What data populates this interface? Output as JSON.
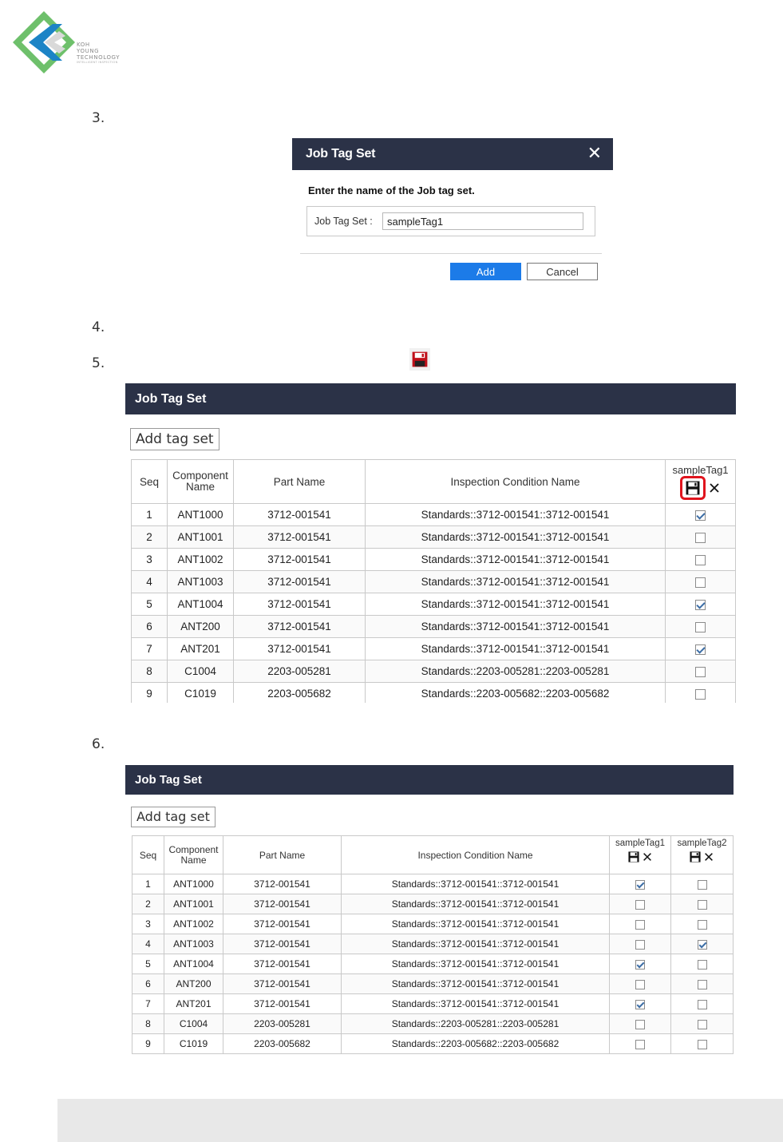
{
  "logo": {
    "line1": "KOH",
    "line2": "YOUNG",
    "line3": "TECHNOLOGY",
    "tagline": "INTELLIGENT INSPECTION",
    "colors": {
      "green": "#6ec06b",
      "blue": "#1c84c6",
      "gray": "#d9d9d9"
    }
  },
  "steps": [
    "3.",
    "4.",
    "5.",
    "6."
  ],
  "dialog": {
    "title": "Job Tag Set",
    "close_icon": "close-icon",
    "prompt": "Enter the name of the Job tag set.",
    "field_label": "Job Tag Set :",
    "field_value": "sampleTag1",
    "add_label": "Add",
    "cancel_label": "Cancel"
  },
  "panel1": {
    "title": "Job Tag Set",
    "add_tag_label": "Add tag set",
    "columns": {
      "seq": "Seq",
      "component": "Component Name",
      "part": "Part Name",
      "condition": "Inspection Condition Name"
    },
    "tags": [
      "sampleTag1"
    ],
    "rows": [
      {
        "seq": "1",
        "component": "ANT1000",
        "part": "3712-001541",
        "condition": "Standards::3712-001541::3712-001541",
        "checks": [
          true
        ]
      },
      {
        "seq": "2",
        "component": "ANT1001",
        "part": "3712-001541",
        "condition": "Standards::3712-001541::3712-001541",
        "checks": [
          false
        ]
      },
      {
        "seq": "3",
        "component": "ANT1002",
        "part": "3712-001541",
        "condition": "Standards::3712-001541::3712-001541",
        "checks": [
          false
        ]
      },
      {
        "seq": "4",
        "component": "ANT1003",
        "part": "3712-001541",
        "condition": "Standards::3712-001541::3712-001541",
        "checks": [
          false
        ]
      },
      {
        "seq": "5",
        "component": "ANT1004",
        "part": "3712-001541",
        "condition": "Standards::3712-001541::3712-001541",
        "checks": [
          true
        ]
      },
      {
        "seq": "6",
        "component": "ANT200",
        "part": "3712-001541",
        "condition": "Standards::3712-001541::3712-001541",
        "checks": [
          false
        ]
      },
      {
        "seq": "7",
        "component": "ANT201",
        "part": "3712-001541",
        "condition": "Standards::3712-001541::3712-001541",
        "checks": [
          true
        ]
      },
      {
        "seq": "8",
        "component": "C1004",
        "part": "2203-005281",
        "condition": "Standards::2203-005281::2203-005281",
        "checks": [
          false
        ]
      },
      {
        "seq": "9",
        "component": "C1019",
        "part": "2203-005682",
        "condition": "Standards::2203-005682::2203-005682",
        "checks": [
          false
        ]
      }
    ]
  },
  "panel2": {
    "title": "Job Tag Set",
    "add_tag_label": "Add tag set",
    "columns": {
      "seq": "Seq",
      "component": "Component Name",
      "part": "Part Name",
      "condition": "Inspection Condition Name"
    },
    "tags": [
      "sampleTag1",
      "sampleTag2"
    ],
    "rows": [
      {
        "seq": "1",
        "component": "ANT1000",
        "part": "3712-001541",
        "condition": "Standards::3712-001541::3712-001541",
        "checks": [
          true,
          false
        ]
      },
      {
        "seq": "2",
        "component": "ANT1001",
        "part": "3712-001541",
        "condition": "Standards::3712-001541::3712-001541",
        "checks": [
          false,
          false
        ]
      },
      {
        "seq": "3",
        "component": "ANT1002",
        "part": "3712-001541",
        "condition": "Standards::3712-001541::3712-001541",
        "checks": [
          false,
          false
        ]
      },
      {
        "seq": "4",
        "component": "ANT1003",
        "part": "3712-001541",
        "condition": "Standards::3712-001541::3712-001541",
        "checks": [
          false,
          true
        ]
      },
      {
        "seq": "5",
        "component": "ANT1004",
        "part": "3712-001541",
        "condition": "Standards::3712-001541::3712-001541",
        "checks": [
          true,
          false
        ]
      },
      {
        "seq": "6",
        "component": "ANT200",
        "part": "3712-001541",
        "condition": "Standards::3712-001541::3712-001541",
        "checks": [
          false,
          false
        ]
      },
      {
        "seq": "7",
        "component": "ANT201",
        "part": "3712-001541",
        "condition": "Standards::3712-001541::3712-001541",
        "checks": [
          true,
          false
        ]
      },
      {
        "seq": "8",
        "component": "C1004",
        "part": "2203-005281",
        "condition": "Standards::2203-005281::2203-005281",
        "checks": [
          false,
          false
        ]
      },
      {
        "seq": "9",
        "component": "C1019",
        "part": "2203-005682",
        "condition": "Standards::2203-005682::2203-005682",
        "checks": [
          false,
          false
        ]
      }
    ]
  },
  "colors": {
    "header_bg": "#2b3247",
    "primary_button": "#1c7be8",
    "highlight_red": "#e0141d",
    "check_mark": "#3d6ea6"
  }
}
